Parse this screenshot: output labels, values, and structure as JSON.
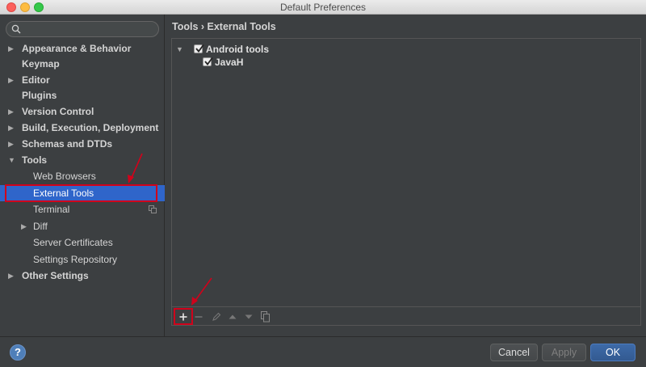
{
  "window": {
    "title": "Default Preferences"
  },
  "sidebar": {
    "search_placeholder": "",
    "items": [
      {
        "label": "Appearance & Behavior"
      },
      {
        "label": "Keymap"
      },
      {
        "label": "Editor"
      },
      {
        "label": "Plugins"
      },
      {
        "label": "Version Control"
      },
      {
        "label": "Build, Execution, Deployment"
      },
      {
        "label": "Schemas and DTDs"
      },
      {
        "label": "Tools"
      },
      {
        "label": "Web Browsers"
      },
      {
        "label": "External Tools"
      },
      {
        "label": "Terminal"
      },
      {
        "label": "Diff"
      },
      {
        "label": "Server Certificates"
      },
      {
        "label": "Settings Repository"
      },
      {
        "label": "Other Settings"
      }
    ],
    "selected": "External Tools"
  },
  "main": {
    "breadcrumb": "Tools › External Tools",
    "tree": [
      {
        "label": "Android tools",
        "checked": true,
        "expanded": true
      },
      {
        "label": "JavaH",
        "checked": true
      }
    ]
  },
  "footer": {
    "help_label": "?",
    "cancel_label": "Cancel",
    "apply_label": "Apply",
    "ok_label": "OK"
  },
  "colors": {
    "selection": "#2f65ca",
    "annotation": "#d0021b",
    "background": "#3c3f41"
  }
}
